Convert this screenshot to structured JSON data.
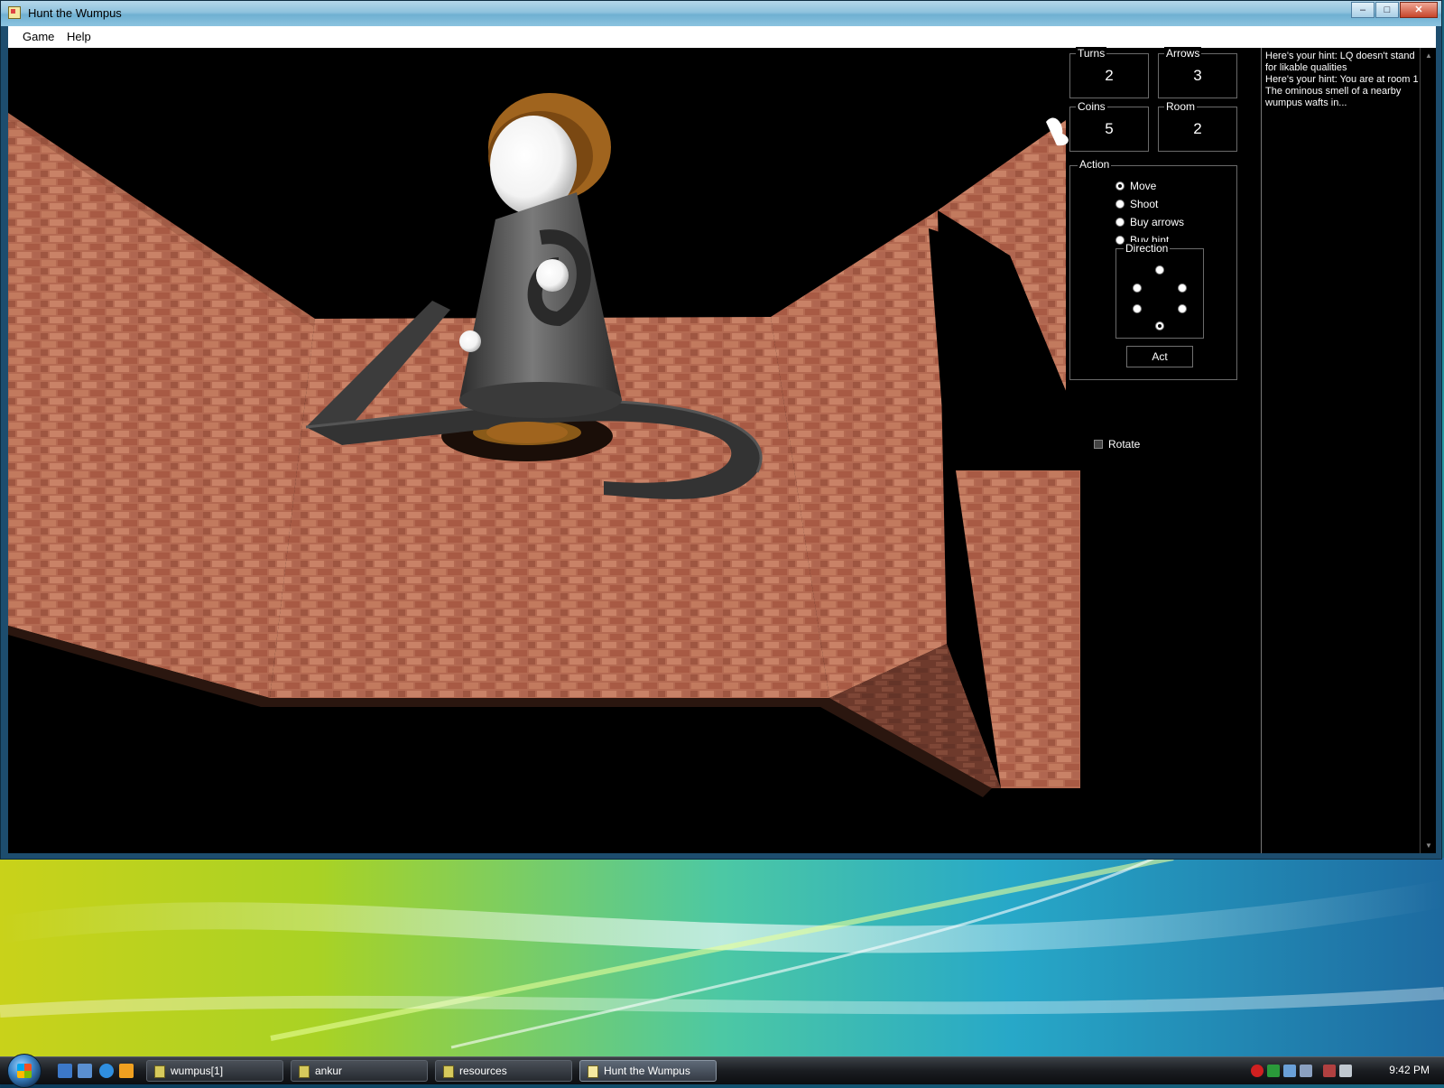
{
  "window": {
    "title": "Hunt the Wumpus",
    "controls": {
      "minimize": "–",
      "maximize": "□",
      "close": "✕"
    }
  },
  "menu": {
    "items": [
      "Game",
      "Help"
    ]
  },
  "stats": {
    "turns": {
      "label": "Turns",
      "value": "2"
    },
    "arrows": {
      "label": "Arrows",
      "value": "3"
    },
    "coins": {
      "label": "Coins",
      "value": "5"
    },
    "room": {
      "label": "Room",
      "value": "2"
    }
  },
  "action": {
    "label": "Action",
    "options": [
      {
        "label": "Move",
        "checked": true
      },
      {
        "label": "Shoot",
        "checked": false
      },
      {
        "label": "Buy arrows",
        "checked": false
      },
      {
        "label": "Buy hint",
        "checked": false
      }
    ],
    "direction": {
      "label": "Direction",
      "selected_index": 5
    },
    "act_label": "Act"
  },
  "rotate": {
    "label": "Rotate",
    "checked": false
  },
  "hints": {
    "lines": [
      "Here's your hint: LQ doesn't stand for likable qualities",
      "Here's your hint: You are at room 1",
      "The ominous smell of a nearby wumpus wafts in..."
    ]
  },
  "taskbar": {
    "buttons": [
      {
        "label": "wumpus[1]",
        "active": false
      },
      {
        "label": "ankur",
        "active": false
      },
      {
        "label": "resources",
        "active": false
      },
      {
        "label": "Hunt the Wumpus",
        "active": true
      }
    ],
    "clock": "9:42 PM"
  },
  "colors": {
    "brick": "#b0624a",
    "brick_dark": "#7a3f30",
    "figure_gray": "#4a4a4a",
    "hat_brown": "#a0641e"
  }
}
